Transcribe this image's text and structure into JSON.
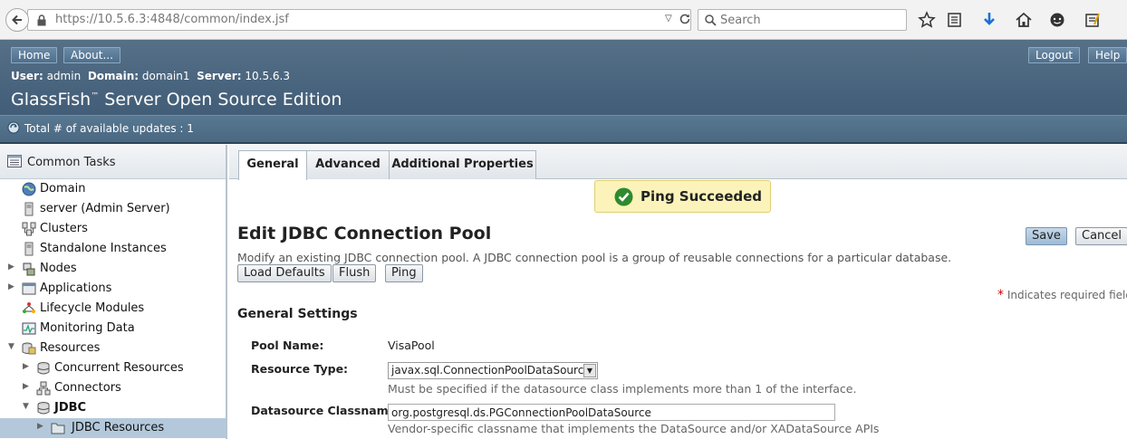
{
  "browser": {
    "url_host": "https://10.5.6.3",
    "url_path": ":4848/common/index.jsf",
    "search_placeholder": "Search"
  },
  "header": {
    "home_label": "Home",
    "about_label": "About...",
    "logout_label": "Logout",
    "help_label": "Help",
    "user_key": "User:",
    "user_value": "admin",
    "domain_key": "Domain:",
    "domain_value": "domain1",
    "server_key": "Server:",
    "server_value": "10.5.6.3",
    "product_title_a": "GlassFish",
    "product_title_tm": "™",
    "product_title_b": " Server Open Source Edition",
    "update_text": "Total # of available updates : 1"
  },
  "sidebar": {
    "title": "Common Tasks",
    "items": [
      {
        "label": "Domain"
      },
      {
        "label": "server (Admin Server)"
      },
      {
        "label": "Clusters"
      },
      {
        "label": "Standalone Instances"
      },
      {
        "label": "Nodes"
      },
      {
        "label": "Applications"
      },
      {
        "label": "Lifecycle Modules"
      },
      {
        "label": "Monitoring Data"
      },
      {
        "label": "Resources"
      },
      {
        "label": "Concurrent Resources"
      },
      {
        "label": "Connectors"
      },
      {
        "label": "JDBC"
      },
      {
        "label": "JDBC Resources"
      }
    ]
  },
  "main": {
    "tabs": [
      {
        "label": "General"
      },
      {
        "label": "Advanced"
      },
      {
        "label": "Additional Properties"
      }
    ],
    "ping_message": "Ping Succeeded",
    "page_title": "Edit JDBC Connection Pool",
    "page_description": "Modify an existing JDBC connection pool. A JDBC connection pool is a group of reusable connections for a particular database.",
    "save_label": "Save",
    "cancel_label": "Cancel",
    "load_defaults_label": "Load Defaults",
    "flush_label": "Flush",
    "ping_label": "Ping",
    "required_star": "*",
    "required_note": " Indicates required field",
    "section_title": "General Settings",
    "pool_name_label": "Pool Name:",
    "pool_name_value": "VisaPool",
    "resource_type_label": "Resource Type:",
    "resource_type_value": "javax.sql.ConnectionPoolDataSource",
    "resource_type_help": "Must be specified if the datasource class implements more than 1 of the interface.",
    "datasource_label": "Datasource Classname:",
    "datasource_value": "org.postgresql.ds.PGConnectionPoolDataSource",
    "datasource_help": "Vendor-specific classname that implements the DataSource and/or XADataSource APIs"
  }
}
